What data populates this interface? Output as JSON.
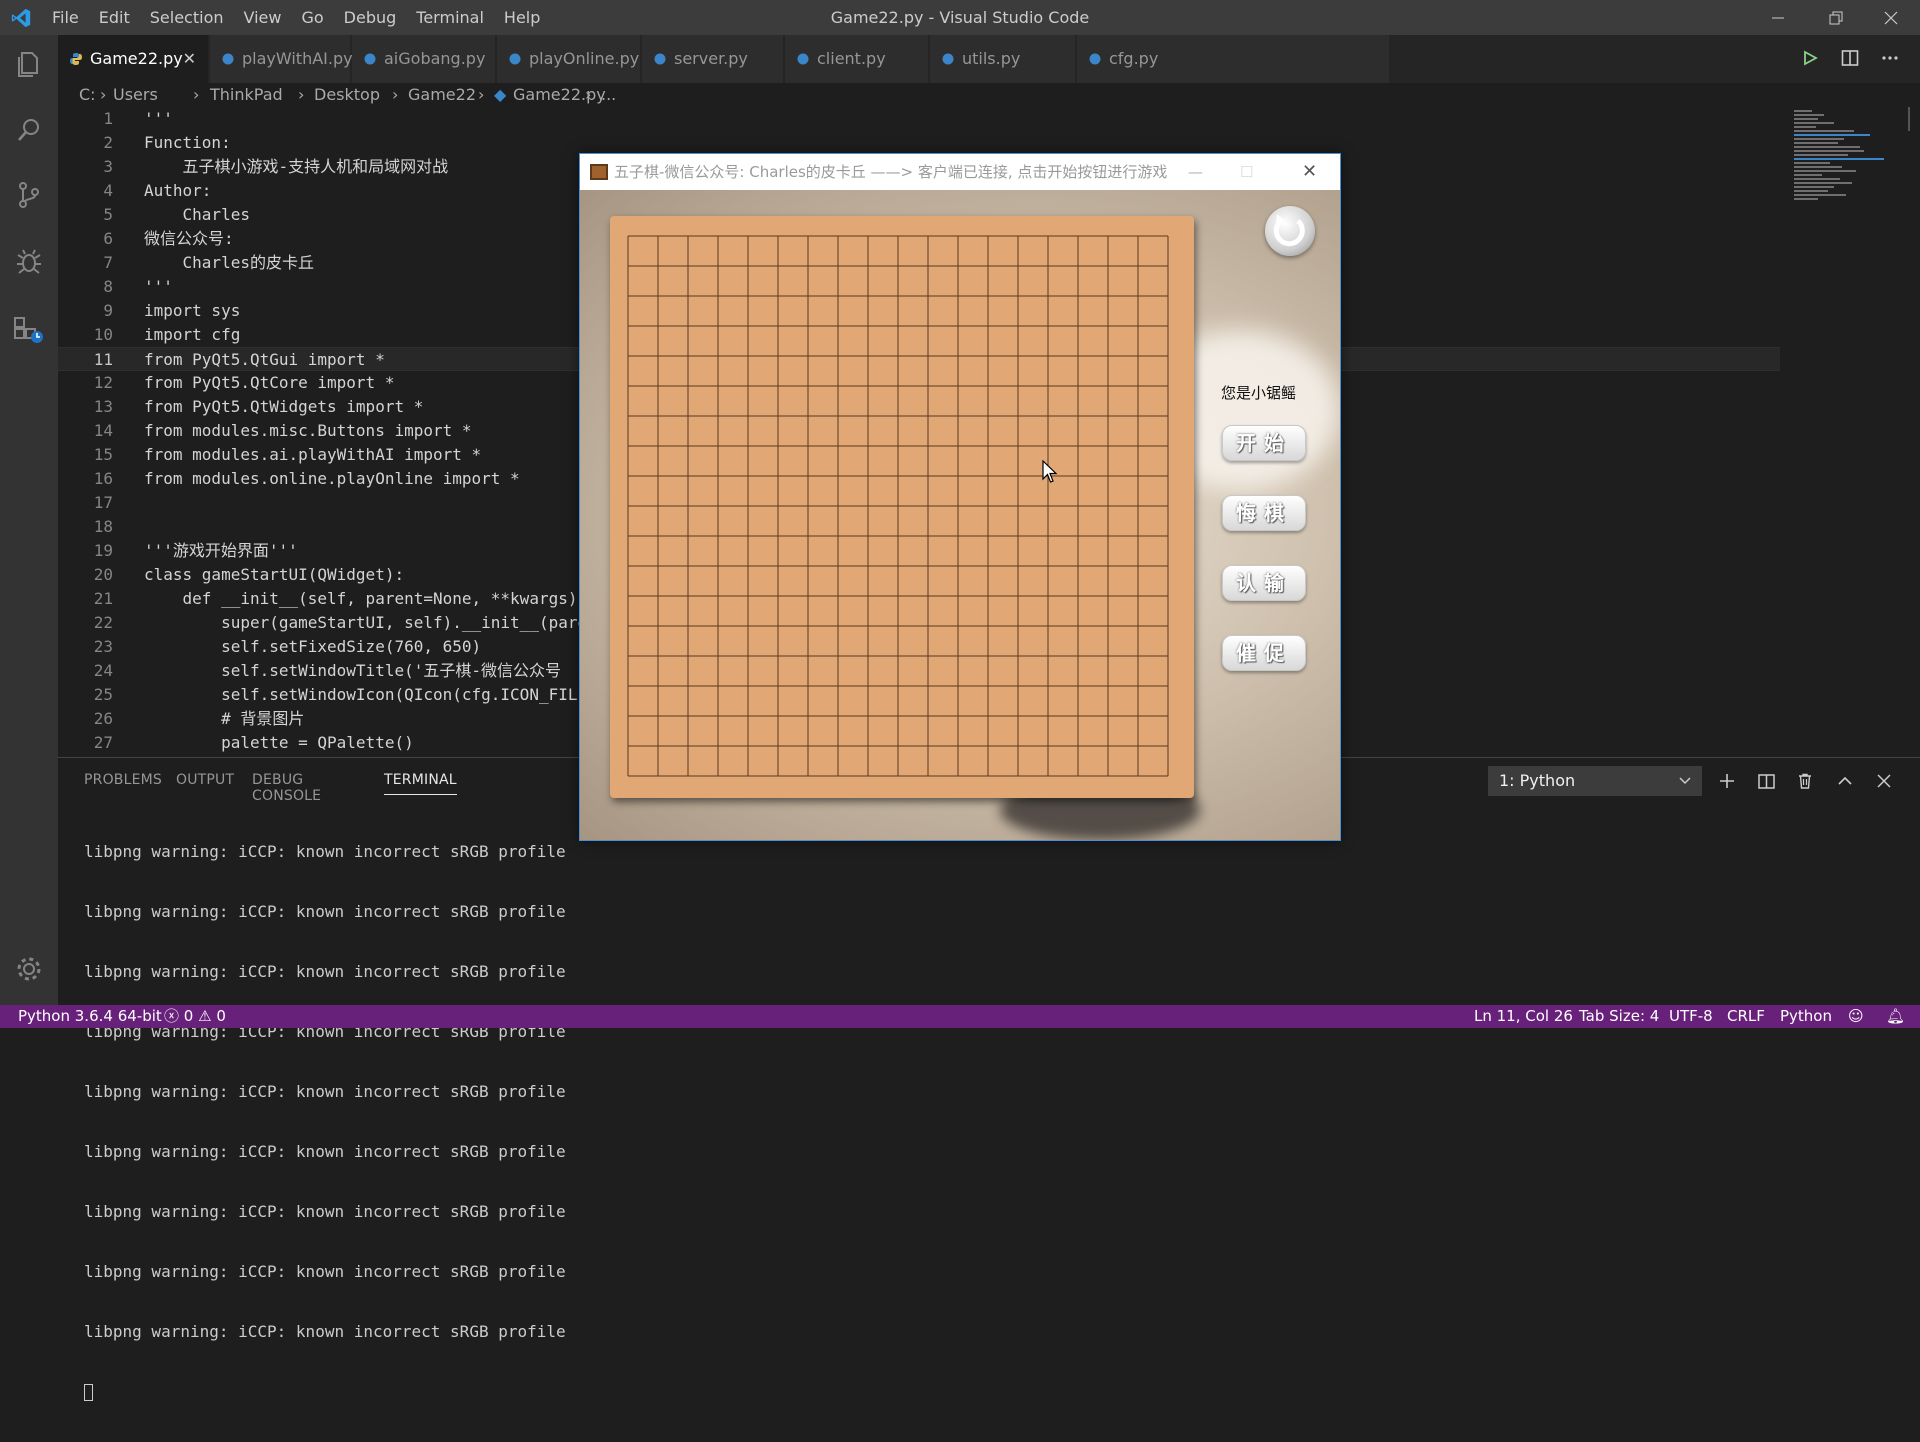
{
  "window": {
    "title": "Game22.py - Visual Studio Code",
    "menu": [
      "File",
      "Edit",
      "Selection",
      "View",
      "Go",
      "Debug",
      "Terminal",
      "Help"
    ]
  },
  "tabs": [
    {
      "label": "Game22.py",
      "active": true
    },
    {
      "label": "playWithAI.py"
    },
    {
      "label": "aiGobang.py"
    },
    {
      "label": "playOnline.py"
    },
    {
      "label": "server.py"
    },
    {
      "label": "client.py"
    },
    {
      "label": "utils.py"
    },
    {
      "label": "cfg.py"
    }
  ],
  "breadcrumb": [
    "C:",
    "Users",
    "ThinkPad",
    "Desktop",
    "Game22",
    "Game22.py",
    "..."
  ],
  "code": {
    "current_line": 11,
    "lines": [
      "'''",
      "Function:",
      "    五子棋小游戏-支持人机和局域网对战",
      "Author:",
      "    Charles",
      "微信公众号:",
      "    Charles的皮卡丘",
      "'''",
      "import sys",
      "import cfg",
      "from PyQt5.QtGui import *",
      "from PyQt5.QtCore import *",
      "from PyQt5.QtWidgets import *",
      "from modules.misc.Buttons import *",
      "from modules.ai.playWithAI import *",
      "from modules.online.playOnline import *",
      "",
      "",
      "'''游戏开始界面'''",
      "class gameStartUI(QWidget):",
      "    def __init__(self, parent=None, **kwargs)",
      "        super(gameStartUI, self).__init__(pare",
      "        self.setFixedSize(760, 650)",
      "        self.setWindowTitle('五子棋-微信公众号",
      "        self.setWindowIcon(QIcon(cfg.ICON_FILE",
      "        # 背景图片",
      "        palette = QPalette()"
    ]
  },
  "panel": {
    "tabs": [
      "PROBLEMS",
      "OUTPUT",
      "DEBUG CONSOLE",
      "TERMINAL"
    ],
    "active_tab": "TERMINAL",
    "terminal_select": "1: Python",
    "terminal_lines": [
      "libpng warning: iCCP: known incorrect sRGB profile",
      "libpng warning: iCCP: known incorrect sRGB profile",
      "libpng warning: iCCP: known incorrect sRGB profile",
      "libpng warning: iCCP: known incorrect sRGB profile",
      "libpng warning: iCCP: known incorrect sRGB profile",
      "libpng warning: iCCP: known incorrect sRGB profile",
      "libpng warning: iCCP: known incorrect sRGB profile",
      "libpng warning: iCCP: known incorrect sRGB profile",
      "libpng warning: iCCP: known incorrect sRGB profile"
    ]
  },
  "status": {
    "interpreter": "Python 3.6.4 64-bit",
    "errors": "0",
    "warnings": "0",
    "position": "Ln 11, Col 26",
    "tab_size": "Tab Size: 4",
    "encoding": "UTF-8",
    "eol": "CRLF",
    "language": "Python"
  },
  "game": {
    "title": "五子棋-微信公众号: Charles的皮卡丘 ——> 客户端已连接, 点击开始按钮进行游戏",
    "player_label": "您是小锯鳐",
    "buttons": [
      "开始",
      "悔棋",
      "认输",
      "催促"
    ],
    "board_lines": 19
  },
  "colors": {
    "status_bar": "#68217a",
    "board": "#e1a774",
    "grid": "#5a3820"
  }
}
